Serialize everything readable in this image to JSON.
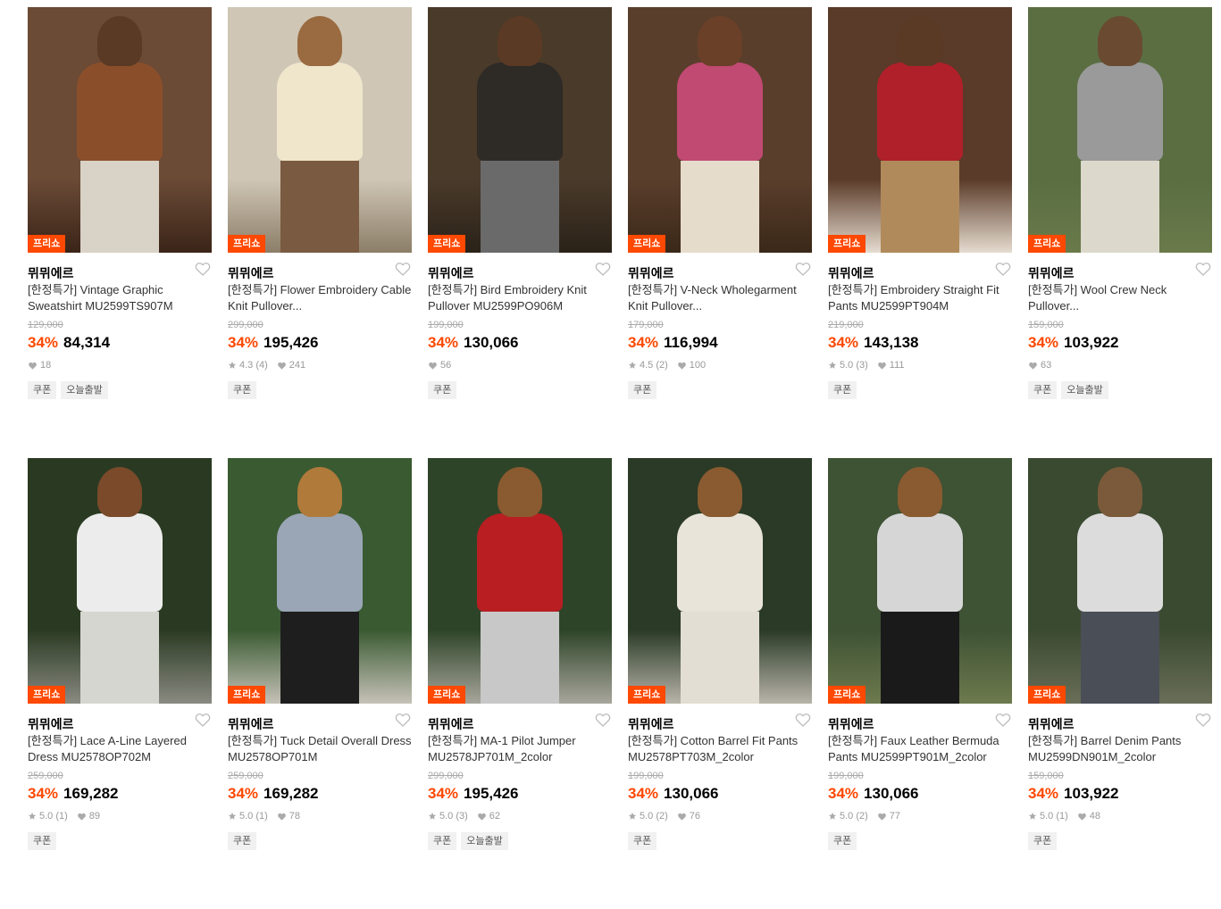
{
  "colors": {
    "accent": "#ff4800",
    "badge_bg": "#ff4800",
    "tag_bg": "#f1f1f1"
  },
  "products": [
    {
      "badge": "프리쇼",
      "brand": "뮈뮈에르",
      "title": "[한정특가] Vintage Graphic Sweatshirt MU2599TS907M",
      "original_price": "129,000",
      "discount": "34%",
      "price": "84,314",
      "rating": "",
      "likes": "18",
      "tags": [
        "쿠폰",
        "오늘출발"
      ],
      "img": {
        "bg": "#6b4a36",
        "floor": "#3a2418",
        "hair": "#5a3a24",
        "top": "#8a4f2a",
        "bottom": "#d9d2c6"
      }
    },
    {
      "badge": "프리쇼",
      "brand": "뮈뮈에르",
      "title": "[한정특가] Flower Embroidery Cable Knit Pullover...",
      "original_price": "299,000",
      "discount": "34%",
      "price": "195,426",
      "rating": "4.3 (4)",
      "likes": "241",
      "tags": [
        "쿠폰"
      ],
      "img": {
        "bg": "#cfc6b5",
        "floor": "#8c7e68",
        "hair": "#9a6a40",
        "top": "#efe6cc",
        "bottom": "#7a5a40"
      }
    },
    {
      "badge": "프리쇼",
      "brand": "뮈뮈에르",
      "title": "[한정특가] Bird Embroidery Knit Pullover MU2599PO906M",
      "original_price": "199,000",
      "discount": "34%",
      "price": "130,066",
      "rating": "",
      "likes": "56",
      "tags": [
        "쿠폰"
      ],
      "img": {
        "bg": "#4a3a2a",
        "floor": "#2a2218",
        "hair": "#5a3a24",
        "top": "#2e2a26",
        "bottom": "#6a6a6a"
      }
    },
    {
      "badge": "프리쇼",
      "brand": "뮈뮈에르",
      "title": "[한정특가] V-Neck Wholegarment Knit Pullover...",
      "original_price": "179,000",
      "discount": "34%",
      "price": "116,994",
      "rating": "4.5 (2)",
      "likes": "100",
      "tags": [
        "쿠폰"
      ],
      "img": {
        "bg": "#5a3e2c",
        "floor": "#3a2818",
        "hair": "#6a4028",
        "top": "#c04a72",
        "bottom": "#e6dccc"
      }
    },
    {
      "badge": "프리쇼",
      "brand": "뮈뮈에르",
      "title": "[한정특가] Embroidery Straight Fit Pants MU2599PT904M",
      "original_price": "219,000",
      "discount": "34%",
      "price": "143,138",
      "rating": "5.0 (3)",
      "likes": "111",
      "tags": [
        "쿠폰"
      ],
      "img": {
        "bg": "#5a3a28",
        "floor": "#e6dcd0",
        "hair": "#5a3a24",
        "top": "#b0202a",
        "bottom": "#b08a5a"
      }
    },
    {
      "badge": "프리쇼",
      "brand": "뮈뮈에르",
      "title": "[한정특가] Wool Crew Neck Pullover...",
      "original_price": "159,000",
      "discount": "34%",
      "price": "103,922",
      "rating": "",
      "likes": "63",
      "tags": [
        "쿠폰",
        "오늘출발"
      ],
      "img": {
        "bg": "#5a6e42",
        "floor": "#6a7a4a",
        "hair": "#6a4a30",
        "top": "#9a9a9a",
        "bottom": "#dcd8cc"
      }
    },
    {
      "badge": "프리쇼",
      "brand": "뮈뮈에르",
      "title": "[한정특가] Lace A-Line Layered Dress MU2578OP702M",
      "original_price": "259,000",
      "discount": "34%",
      "price": "169,282",
      "rating": "5.0 (1)",
      "likes": "89",
      "tags": [
        "쿠폰"
      ],
      "img": {
        "bg": "#2a3a22",
        "floor": "#8a8a82",
        "hair": "#7a4a2a",
        "top": "#ececec",
        "bottom": "#d6d6d0"
      }
    },
    {
      "badge": "프리쇼",
      "brand": "뮈뮈에르",
      "title": "[한정특가] Tuck Detail Overall Dress MU2578OP701M",
      "original_price": "259,000",
      "discount": "34%",
      "price": "169,282",
      "rating": "5.0 (1)",
      "likes": "78",
      "tags": [
        "쿠폰"
      ],
      "img": {
        "bg": "#3a5a32",
        "floor": "#c6c2b8",
        "hair": "#b07a3a",
        "top": "#9aa6b6",
        "bottom": "#1e1e1e"
      }
    },
    {
      "badge": "프리쇼",
      "brand": "뮈뮈에르",
      "title": "[한정특가] MA-1 Pilot Jumper MU2578JP701M_2color",
      "original_price": "299,000",
      "discount": "34%",
      "price": "195,426",
      "rating": "5.0 (3)",
      "likes": "62",
      "tags": [
        "쿠폰",
        "오늘출발"
      ],
      "img": {
        "bg": "#2e4428",
        "floor": "#a8a69c",
        "hair": "#8a5a30",
        "top": "#b81e22",
        "bottom": "#c8c8c8"
      }
    },
    {
      "badge": "프리쇼",
      "brand": "뮈뮈에르",
      "title": "[한정특가] Cotton Barrel Fit Pants MU2578PT703M_2color",
      "original_price": "199,000",
      "discount": "34%",
      "price": "130,066",
      "rating": "5.0 (2)",
      "likes": "76",
      "tags": [
        "쿠폰"
      ],
      "img": {
        "bg": "#2a3a26",
        "floor": "#b8b4aa",
        "hair": "#8a5a30",
        "top": "#e8e4da",
        "bottom": "#e2ded4"
      }
    },
    {
      "badge": "프리쇼",
      "brand": "뮈뮈에르",
      "title": "[한정특가] Faux Leather Bermuda Pants MU2599PT901M_2color",
      "original_price": "199,000",
      "discount": "34%",
      "price": "130,066",
      "rating": "5.0 (2)",
      "likes": "77",
      "tags": [
        "쿠폰"
      ],
      "img": {
        "bg": "#3e5234",
        "floor": "#6e7a4e",
        "hair": "#8a5a30",
        "top": "#d6d6d6",
        "bottom": "#1a1a1a"
      }
    },
    {
      "badge": "프리쇼",
      "brand": "뮈뮈에르",
      "title": "[한정특가] Barrel Denim Pants MU2599DN901M_2color",
      "original_price": "159,000",
      "discount": "34%",
      "price": "103,922",
      "rating": "5.0 (1)",
      "likes": "48",
      "tags": [
        "쿠폰"
      ],
      "img": {
        "bg": "#3a4a30",
        "floor": "#6a6e58",
        "hair": "#7a5a3a",
        "top": "#dcdcdc",
        "bottom": "#4a4e56"
      }
    }
  ]
}
